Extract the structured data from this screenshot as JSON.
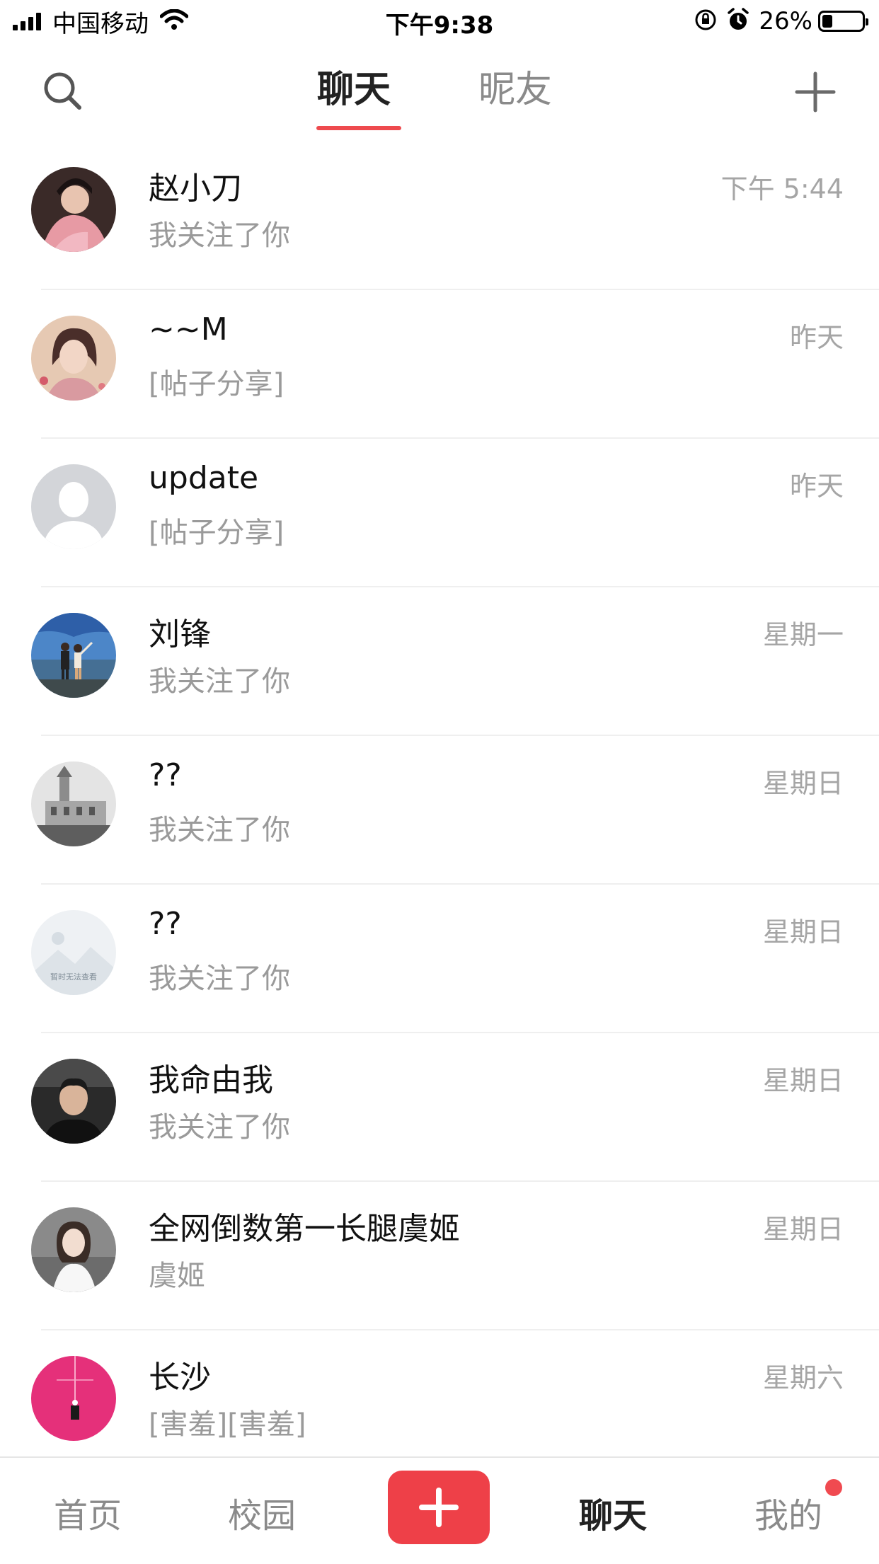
{
  "status_bar": {
    "carrier": "中国移动",
    "time": "下午9:38",
    "battery_percent": "26%",
    "battery_level": 0.26
  },
  "header": {
    "tabs": [
      {
        "label": "聊天",
        "active": true
      },
      {
        "label": "昵友",
        "active": false
      }
    ],
    "icons": {
      "left": "search-icon",
      "right": "plus-icon"
    }
  },
  "chats": [
    {
      "name": "赵小刀",
      "preview": "我关注了你",
      "time": "下午 5:44",
      "avatar": "photo-woman-pink-dress"
    },
    {
      "name": "~~M",
      "preview": "[帖子分享]",
      "time": "昨天",
      "avatar": "illustration-woman"
    },
    {
      "name": "update",
      "preview": "[帖子分享]",
      "time": "昨天",
      "avatar": "default-user-icon"
    },
    {
      "name": "刘锋",
      "preview": "我关注了你",
      "time": "星期一",
      "avatar": "photo-couple-seaside"
    },
    {
      "name": "??",
      "preview": "我关注了你",
      "time": "星期日",
      "avatar": "photo-church-bw"
    },
    {
      "name": "??",
      "preview": "我关注了你",
      "time": "星期日",
      "avatar": "image-unavailable",
      "avatar_caption": "暂时无法查看"
    },
    {
      "name": "我命由我",
      "preview": "我关注了你",
      "time": "星期日",
      "avatar": "photo-man-in-car"
    },
    {
      "name": "全网倒数第一长腿虞姬",
      "preview": "虞姬",
      "time": "星期日",
      "avatar": "photo-woman-white-dress"
    },
    {
      "name": "长沙",
      "preview": "[害羞][害羞]",
      "time": "星期六",
      "avatar": "pink-illustration"
    }
  ],
  "tab_bar": {
    "items": [
      {
        "label": "首页"
      },
      {
        "label": "校园"
      },
      {
        "label": "聊天",
        "active": true
      },
      {
        "label": "我的",
        "badge": true
      }
    ]
  },
  "colors": {
    "accent": "#ee4a4e",
    "post_button": "#ee4048",
    "muted_text": "#9a9a9a"
  }
}
